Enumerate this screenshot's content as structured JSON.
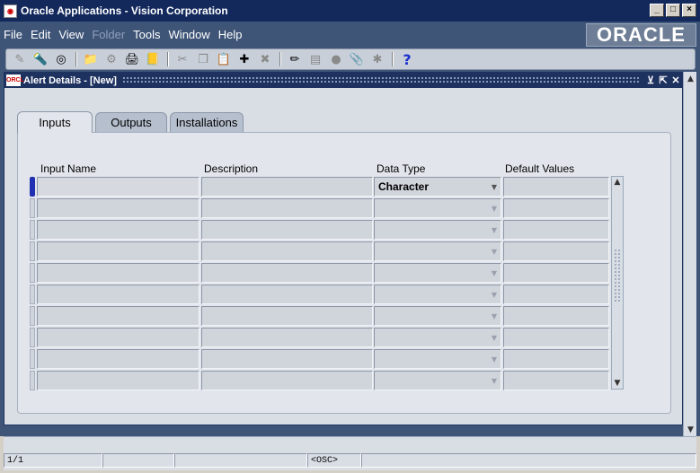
{
  "window": {
    "title": "Oracle Applications - Vision Corporation"
  },
  "menu": [
    "File",
    "Edit",
    "View",
    "Folder",
    "Tools",
    "Window",
    "Help"
  ],
  "brand": {
    "logo_text": "ORACLE"
  },
  "form": {
    "title": "Alert Details - [New]"
  },
  "tabs": [
    {
      "label": "Inputs",
      "active": true
    },
    {
      "label": "Outputs",
      "active": false
    },
    {
      "label": "Installations",
      "active": false
    }
  ],
  "grid": {
    "headers": {
      "input_name": "Input Name",
      "description": "Description",
      "data_type": "Data Type",
      "default_values": "Default Values"
    },
    "first_row_data_type": "Character",
    "row_count": 10
  },
  "status": {
    "record": "1/1",
    "mode": "<OSC>"
  },
  "colors": {
    "navy": "#13295c",
    "slate": "#3f5578",
    "form_bg": "#e2e6ec"
  }
}
